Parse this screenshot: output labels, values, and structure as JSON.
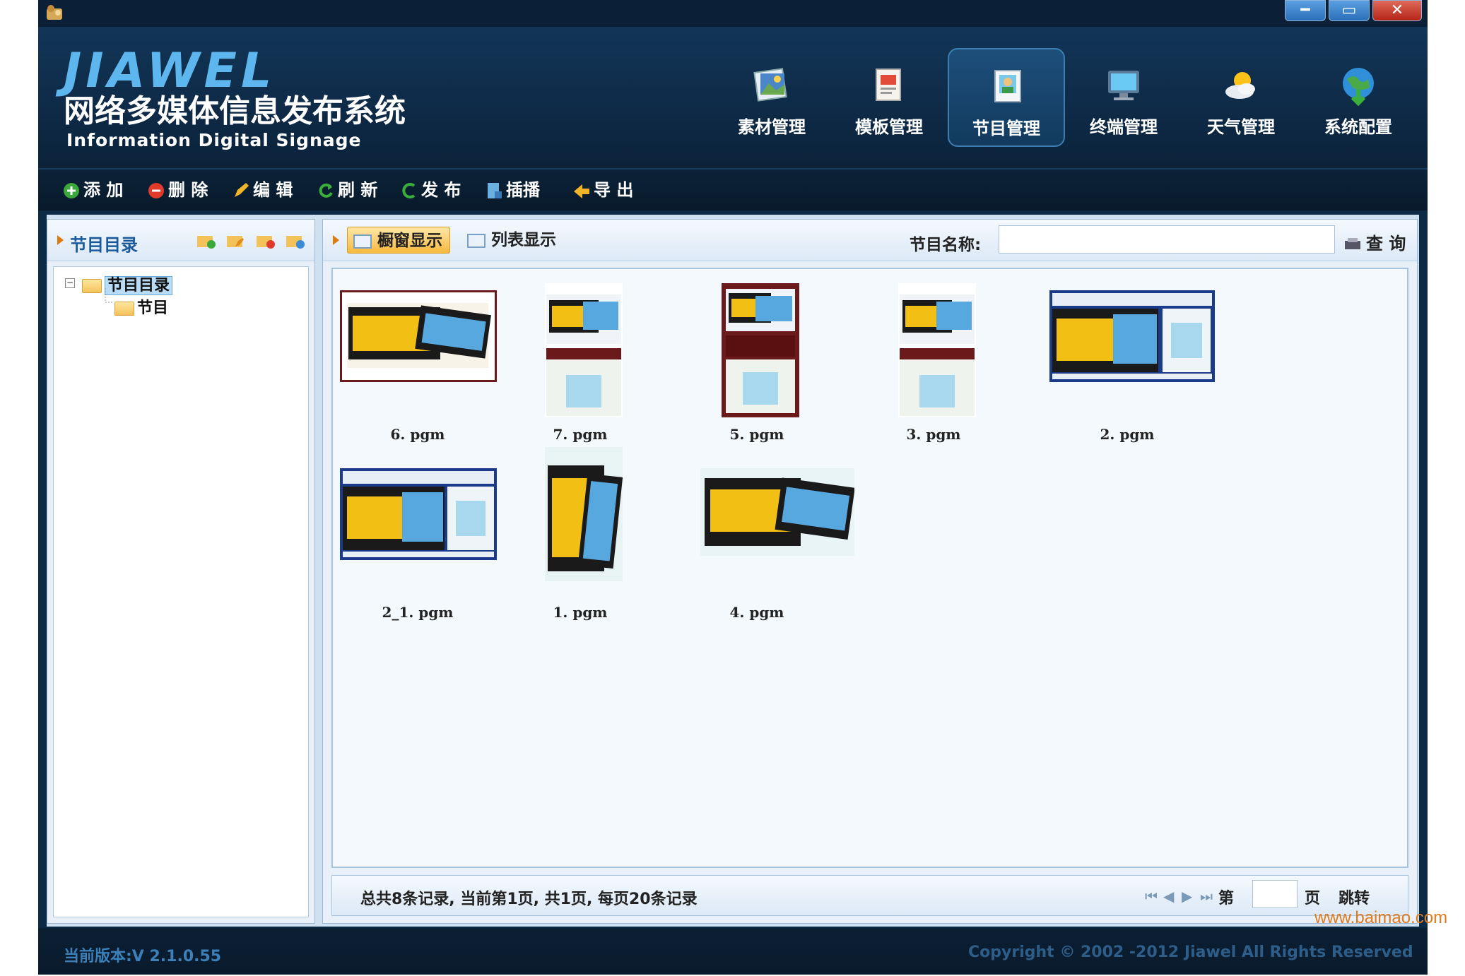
{
  "titlebar": {
    "minimize_icon": "minimize-icon",
    "maximize_icon": "maximize-icon",
    "close_icon": "close-icon",
    "min_glyph": "━",
    "max_glyph": "▭",
    "close_glyph": "✕"
  },
  "header": {
    "brand": "JIAWEL",
    "title": "网络多媒体信息发布系统",
    "subtitle": "Information Digital Signage"
  },
  "nav": {
    "active_index": 2,
    "items": [
      {
        "label": "素材管理",
        "icon": "materials-icon"
      },
      {
        "label": "模板管理",
        "icon": "template-icon"
      },
      {
        "label": "节目管理",
        "icon": "program-icon"
      },
      {
        "label": "终端管理",
        "icon": "terminal-icon"
      },
      {
        "label": "天气管理",
        "icon": "weather-icon"
      },
      {
        "label": "系统配置",
        "icon": "globe-icon"
      }
    ]
  },
  "toolbar": {
    "add": "添 加",
    "delete": "删 除",
    "edit": "编 辑",
    "refresh": "刷 新",
    "publish": "发 布",
    "insert": "插播",
    "export": "导 出"
  },
  "left_panel": {
    "title": "节目目录",
    "tree": {
      "root": "节目目录",
      "child": "节目"
    }
  },
  "right_panel": {
    "view_thumbnail": "橱窗显示",
    "view_list": "列表显示",
    "search_label": "节目名称:",
    "search_value": "",
    "query_button": "查 询",
    "items": [
      {
        "name": "6. pgm"
      },
      {
        "name": "7. pgm"
      },
      {
        "name": "5. pgm"
      },
      {
        "name": "3. pgm"
      },
      {
        "name": "2. pgm"
      },
      {
        "name": "2_1. pgm"
      },
      {
        "name": "1. pgm"
      },
      {
        "name": "4. pgm"
      }
    ],
    "status": "总共8条记录, 当前第1页, 共1页, 每页20条记录",
    "pager": {
      "page_prefix": "第",
      "page_suffix": "页",
      "goto": "跳转",
      "page_value": ""
    }
  },
  "footer": {
    "version": "当前版本:V 2.1.0.55",
    "copyright": "Copyright © 2002 -2012 Jiawel All Rights Reserved"
  },
  "watermark": "www.baimao.com",
  "colors": {
    "header_bg": "#0e2a47",
    "brand": "#5db7ee",
    "active_view": "#f6b93e",
    "panel_bg": "#e8f1fa"
  }
}
